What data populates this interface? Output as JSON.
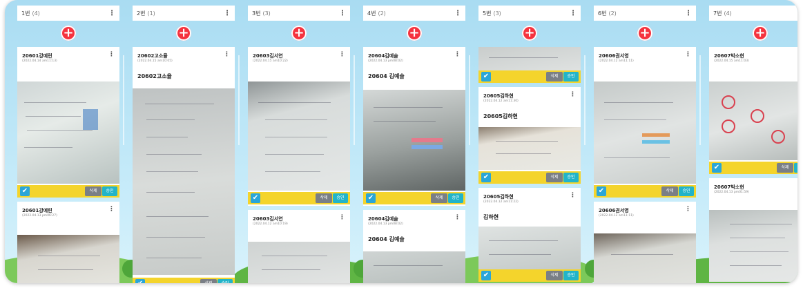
{
  "columns": [
    {
      "title": "1번",
      "count": "(4)"
    },
    {
      "title": "2번",
      "count": "(1)"
    },
    {
      "title": "3번",
      "count": "(3)"
    },
    {
      "title": "4번",
      "count": "(2)"
    },
    {
      "title": "5번",
      "count": "(3)"
    },
    {
      "title": "6번",
      "count": "(2)"
    },
    {
      "title": "7번",
      "count": "(4)"
    }
  ],
  "cards": {
    "c1a": {
      "name": "20601강예린",
      "date": "(2022.04.14 am11:13)"
    },
    "c1b": {
      "name": "20601강예린",
      "date": "(2022.04.13 pm06:27)"
    },
    "c2a": {
      "name": "20602고소율",
      "date": "(2022.04.15 am10:05)",
      "body": "20602고소율"
    },
    "c3a": {
      "name": "20603김서연",
      "date": "(2022.04.15 am10:22)"
    },
    "c3b": {
      "name": "20603김서연",
      "date": "(2022.04.12 am10:19)"
    },
    "c4a": {
      "name": "20604김예슬",
      "date": "(2022.04.13 pm08:02)",
      "body": "20604 김예슬"
    },
    "c4b": {
      "name": "20604김예슬",
      "date": "(2022.04.13 pm08:02)",
      "body": "20604 김예슬"
    },
    "c5b": {
      "name": "20605김하현",
      "date": "(2022.04.12 am11:30)",
      "body": "20605김하현"
    },
    "c5c": {
      "name": "20605김하현",
      "date": "(2022.04.12 am11:22)",
      "body": "김하현"
    },
    "c6a": {
      "name": "20606권서영",
      "date": "(2022.04.12 am11:11)"
    },
    "c6b": {
      "name": "20606권서영",
      "date": "(2022.04.12 am11:11)"
    },
    "c7a": {
      "name": "20607박소현",
      "date": "(2022.04.15 am11:03)"
    },
    "c7b": {
      "name": "20607박소현",
      "date": "(2022.04.13 pm01:59)"
    }
  },
  "actions": {
    "delete": "삭제",
    "approve": "승인",
    "check": "✔",
    "add": "+",
    "more": "⋮"
  },
  "colors": {
    "accent_add": "#f5333f",
    "footer": "#f4d42c",
    "check": "#2aa6d8",
    "approve": "#22b4c9",
    "delete": "#7a7f86",
    "sky": "#bfe5f6"
  }
}
